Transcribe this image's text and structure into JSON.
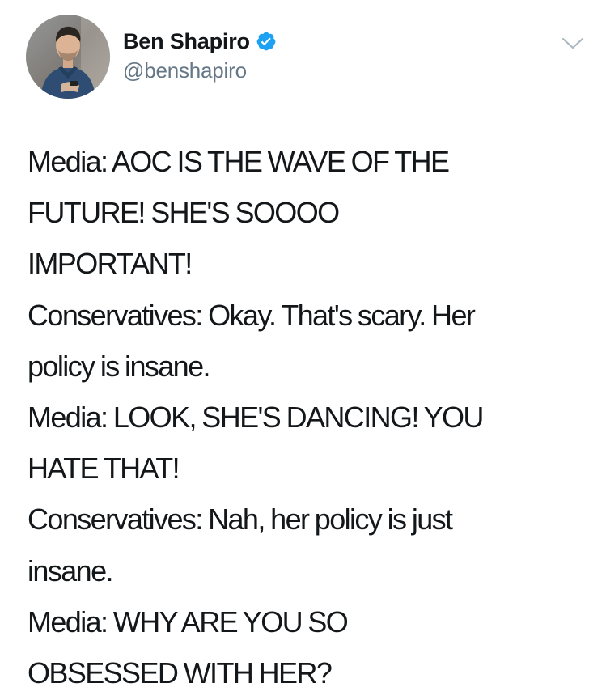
{
  "author": {
    "display_name": "Ben Shapiro",
    "handle": "@benshapiro",
    "verified": true,
    "verified_icon": "verified-badge-icon",
    "verified_color": "#1da1f2",
    "avatar": "profile-photo"
  },
  "menu": {
    "icon": "chevron-down-icon",
    "color": "#aab8c2"
  },
  "tweet": {
    "lines": [
      "Media: AOC IS THE WAVE OF THE",
      "FUTURE! SHE'S SOOOO",
      "IMPORTANT!",
      "Conservatives: Okay. That's scary. Her",
      "policy is insane.",
      "Media: LOOK, SHE'S DANCING! YOU",
      "HATE THAT!",
      "Conservatives: Nah, her policy is just",
      "insane.",
      "Media: WHY ARE YOU SO",
      "OBSESSED WITH HER?"
    ]
  },
  "colors": {
    "text": "#14171a",
    "secondary_text": "#657786",
    "background": "#ffffff"
  }
}
